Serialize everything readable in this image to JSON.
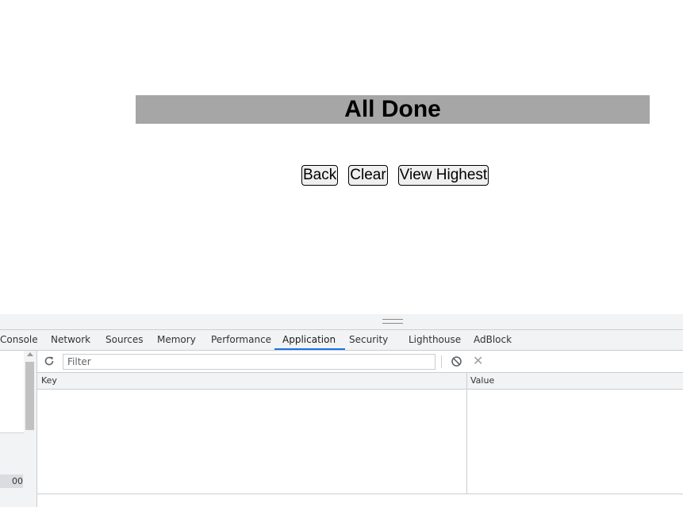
{
  "page": {
    "heading": "All Done",
    "buttons": {
      "back": "Back",
      "clear": "Clear",
      "view_highest": "View Highest"
    },
    "heading_bar_color": "#a6a6a6"
  },
  "devtools": {
    "tabs": [
      {
        "label": "Console"
      },
      {
        "label": "Network"
      },
      {
        "label": "Sources"
      },
      {
        "label": "Memory"
      },
      {
        "label": "Performance"
      },
      {
        "label": "Application",
        "active": true
      },
      {
        "label": "Security"
      },
      {
        "label": "Lighthouse"
      },
      {
        "label": "AdBlock"
      }
    ],
    "accent_color": "#1a73e8",
    "toolbar": {
      "filter_placeholder": "Filter",
      "icons": [
        "refresh-icon",
        "block-icon",
        "close-icon"
      ]
    },
    "table": {
      "columns": [
        "Key",
        "Value"
      ],
      "rows": []
    },
    "sidebar": {
      "partial_value": "00"
    }
  }
}
